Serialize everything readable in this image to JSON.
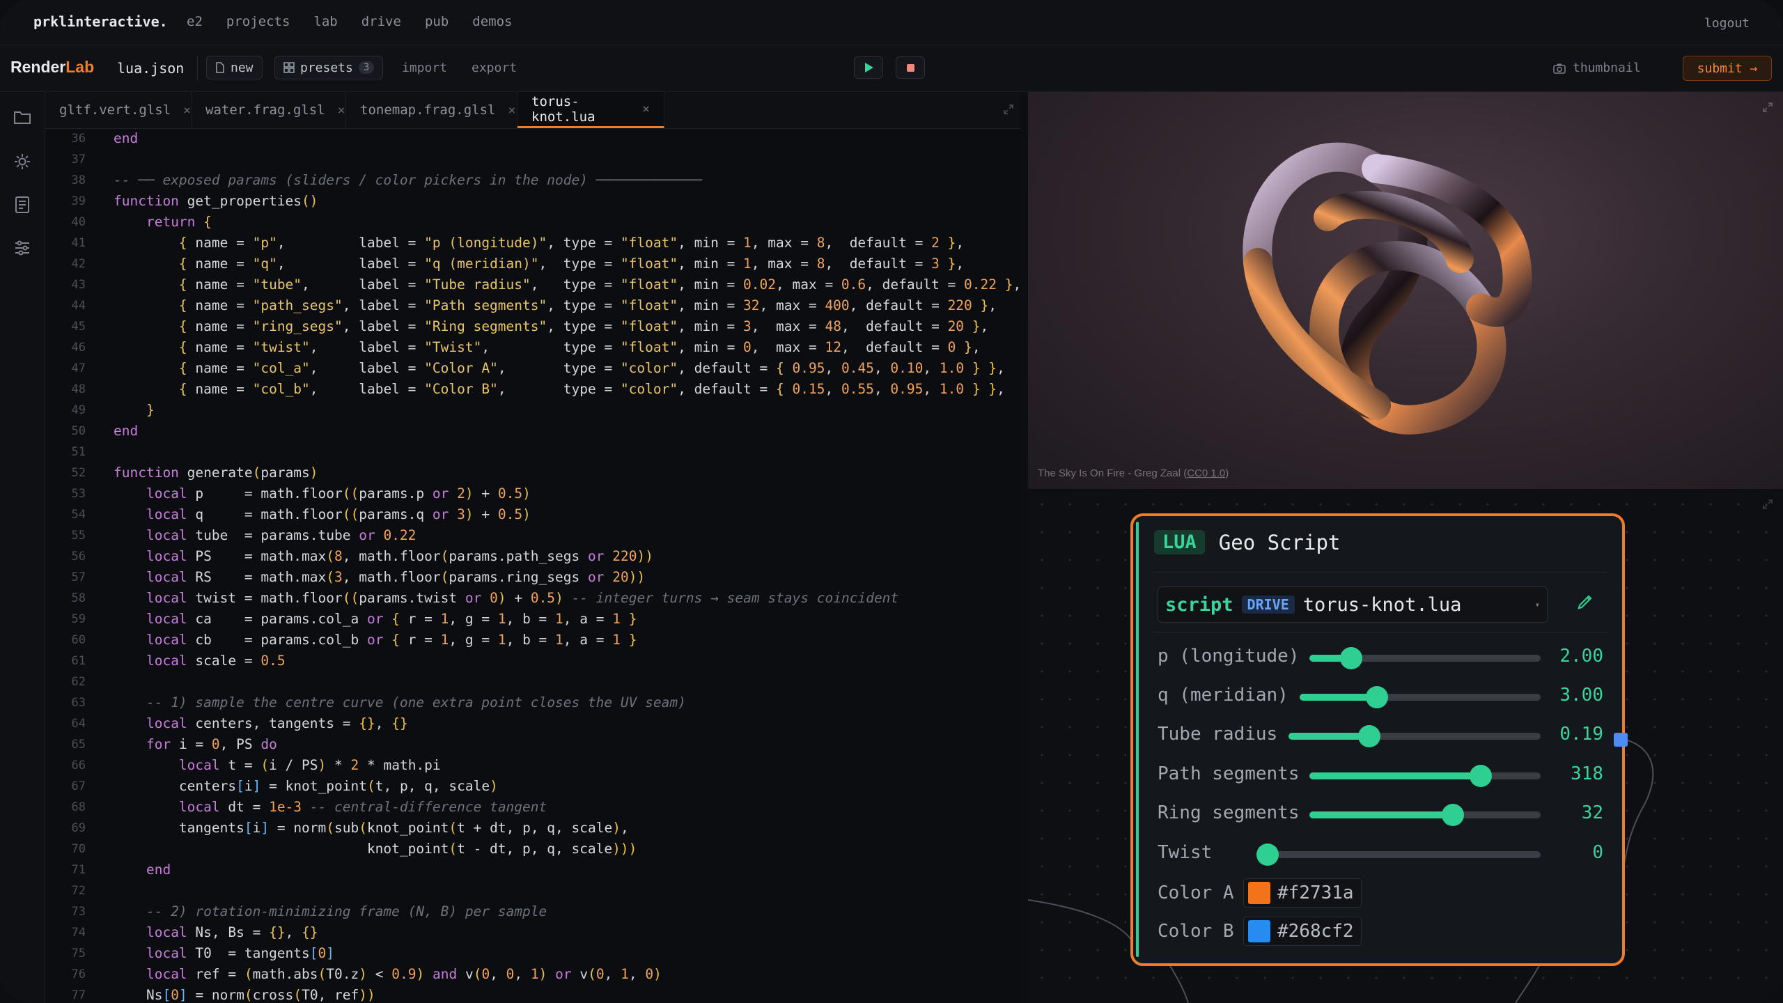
{
  "topnav": {
    "brand": "prklinteractive.",
    "links": [
      "e2",
      "projects",
      "lab",
      "drive",
      "pub",
      "demos"
    ],
    "logout": "logout"
  },
  "toolbar": {
    "logo_a": "Render",
    "logo_b": "Lab",
    "filename": "lua.json",
    "new_label": "new",
    "presets_label": "presets",
    "presets_count": "3",
    "import_label": "import",
    "export_label": "export",
    "thumbnail_label": "thumbnail",
    "submit_label": "submit →"
  },
  "tabs": [
    {
      "label": "gltf.vert.glsl",
      "close": "×"
    },
    {
      "label": "water.frag.glsl",
      "close": "×"
    },
    {
      "label": "tonemap.frag.glsl",
      "close": "×"
    },
    {
      "label": "torus-knot.lua",
      "close": "×",
      "active": true
    }
  ],
  "code": {
    "first_line": 36,
    "lines": [
      "end",
      "",
      "-- ── exposed params (sliders / color pickers in the node) ─────────────",
      "function get_properties()",
      "    return {",
      "        { name = \"p\",         label = \"p (longitude)\", type = \"float\", min = 1, max = 8,  default = 2 },",
      "        { name = \"q\",         label = \"q (meridian)\",  type = \"float\", min = 1, max = 8,  default = 3 },",
      "        { name = \"tube\",      label = \"Tube radius\",   type = \"float\", min = 0.02, max = 0.6, default = 0.22 },",
      "        { name = \"path_segs\", label = \"Path segments\", type = \"float\", min = 32, max = 400, default = 220 },",
      "        { name = \"ring_segs\", label = \"Ring segments\", type = \"float\", min = 3,  max = 48,  default = 20 },",
      "        { name = \"twist\",     label = \"Twist\",         type = \"float\", min = 0,  max = 12,  default = 0 },",
      "        { name = \"col_a\",     label = \"Color A\",       type = \"color\", default = { 0.95, 0.45, 0.10, 1.0 } },",
      "        { name = \"col_b\",     label = \"Color B\",       type = \"color\", default = { 0.15, 0.55, 0.95, 1.0 } },",
      "    }",
      "end",
      "",
      "function generate(params)",
      "    local p     = math.floor((params.p or 2) + 0.5)",
      "    local q     = math.floor((params.q or 3) + 0.5)",
      "    local tube  = params.tube or 0.22",
      "    local PS    = math.max(8, math.floor(params.path_segs or 220))",
      "    local RS    = math.max(3, math.floor(params.ring_segs or 20))",
      "    local twist = math.floor((params.twist or 0) + 0.5) -- integer turns → seam stays coincident",
      "    local ca    = params.col_a or { r = 1, g = 1, b = 1, a = 1 }",
      "    local cb    = params.col_b or { r = 1, g = 1, b = 1, a = 1 }",
      "    local scale = 0.5",
      "",
      "    -- 1) sample the centre curve (one extra point closes the UV seam)",
      "    local centers, tangents = {}, {}",
      "    for i = 0, PS do",
      "        local t = (i / PS) * 2 * math.pi",
      "        centers[i] = knot_point(t, p, q, scale)",
      "        local dt = 1e-3 -- central-difference tangent",
      "        tangents[i] = norm(sub(knot_point(t + dt, p, q, scale),",
      "                               knot_point(t - dt, p, q, scale)))",
      "    end",
      "",
      "    -- 2) rotation-minimizing frame (N, B) per sample",
      "    local Ns, Bs = {}, {}",
      "    local T0  = tangents[0]",
      "    local ref = (math.abs(T0.z) < 0.9) and v(0, 0, 1) or v(0, 1, 0)",
      "    Ns[0] = norm(cross(T0, ref))"
    ]
  },
  "viewport": {
    "caption_prefix": "The Sky Is On Fire - Greg Zaal (",
    "caption_license": "CC0 1.0",
    "caption_suffix": ")"
  },
  "node": {
    "badge": "LUA",
    "title": "Geo Script",
    "script_label": "script",
    "drive_badge": "DRIVE",
    "script_name": "torus-knot.lua",
    "params": [
      {
        "label": "p (longitude)",
        "value": "2.00",
        "fraction": 0.18
      },
      {
        "label": "q (meridian)",
        "value": "3.00",
        "fraction": 0.32
      },
      {
        "label": "Tube radius",
        "value": "0.19",
        "fraction": 0.32
      },
      {
        "label": "Path segments",
        "value": "318",
        "fraction": 0.74
      },
      {
        "label": "Ring segments",
        "value": "32",
        "fraction": 0.62
      },
      {
        "label": "Twist",
        "value": "0",
        "fraction": 0.0
      }
    ],
    "colors": [
      {
        "label": "Color A",
        "hex": "#f2731a"
      },
      {
        "label": "Color B",
        "hex": "#268cf2"
      }
    ]
  },
  "theme": {
    "accent": "#f07d2a",
    "green": "#2fcf92",
    "blue_port": "#4c8df5"
  }
}
